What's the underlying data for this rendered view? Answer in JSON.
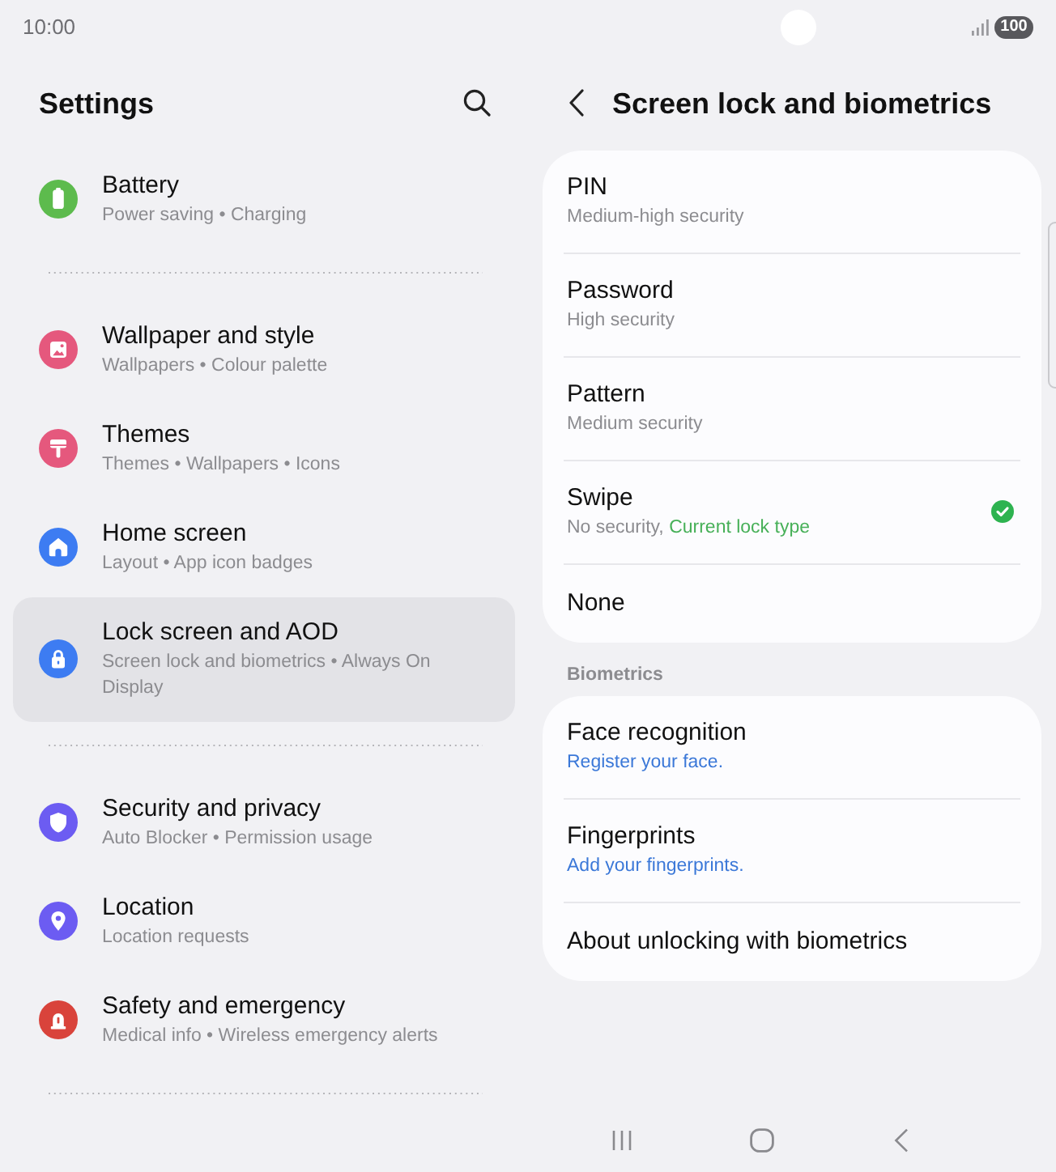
{
  "status_bar": {
    "time": "10:00",
    "battery": "100"
  },
  "settings_panel": {
    "title": "Settings",
    "groups": [
      {
        "items": [
          {
            "title": "Battery",
            "subtitle": "Power saving • Charging",
            "color": "#5dbb4d",
            "selected": false
          }
        ]
      },
      {
        "items": [
          {
            "title": "Wallpaper and style",
            "subtitle": "Wallpapers • Colour palette",
            "color": "#e5587d",
            "selected": false
          },
          {
            "title": "Themes",
            "subtitle": "Themes • Wallpapers • Icons",
            "color": "#e5587d",
            "selected": false
          },
          {
            "title": "Home screen",
            "subtitle": "Layout • App icon badges",
            "color": "#3d7cf2",
            "selected": false
          },
          {
            "title": "Lock screen and AOD",
            "subtitle": "Screen lock and biometrics • Always On Display",
            "color": "#3d7cf2",
            "selected": true
          }
        ]
      },
      {
        "items": [
          {
            "title": "Security and privacy",
            "subtitle": "Auto Blocker • Permission usage",
            "color": "#6c5cf2",
            "selected": false
          },
          {
            "title": "Location",
            "subtitle": "Location requests",
            "color": "#6c5cf2",
            "selected": false
          },
          {
            "title": "Safety and emergency",
            "subtitle": "Medical info • Wireless emergency alerts",
            "color": "#d9433b",
            "selected": false
          }
        ]
      }
    ]
  },
  "detail_panel": {
    "title": "Screen lock and biometrics",
    "lock_types": [
      {
        "title": "PIN",
        "subtitle": "Medium-high security",
        "selected": false
      },
      {
        "title": "Password",
        "subtitle": "High security",
        "selected": false
      },
      {
        "title": "Pattern",
        "subtitle": "Medium security",
        "selected": false
      },
      {
        "title": "Swipe",
        "subtitle": "No security,",
        "status": "Current lock type",
        "selected": true
      },
      {
        "title": "None",
        "selected": false
      }
    ],
    "biometrics": {
      "heading": "Biometrics",
      "items": [
        {
          "title": "Face recognition",
          "action": "Register your face."
        },
        {
          "title": "Fingerprints",
          "action": "Add your fingerprints."
        },
        {
          "title": "About unlocking with biometrics"
        }
      ]
    }
  }
}
